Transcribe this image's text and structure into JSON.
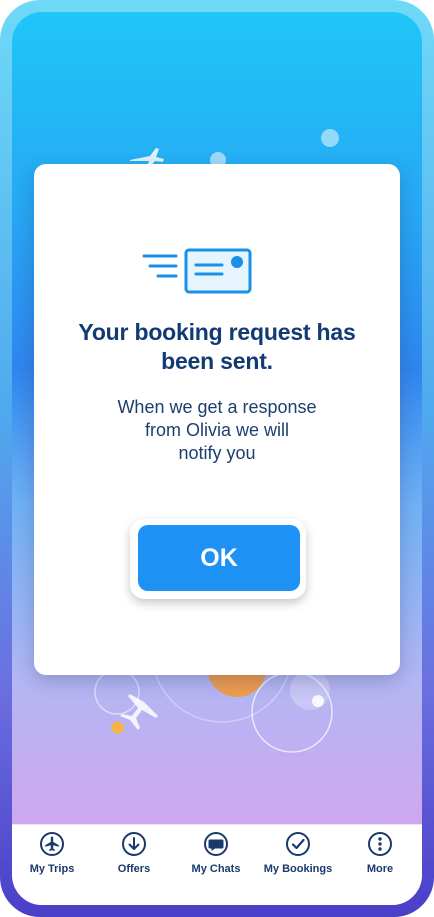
{
  "dialog": {
    "title_line1": "Your booking request has",
    "title_line2": "been sent.",
    "message_line1": "When we get a response",
    "message_line2": "from Olivia we will",
    "message_line3": "notify you",
    "ok_label": "OK",
    "illustration_icon": "envelope-speed-icon"
  },
  "tabbar": {
    "items": [
      {
        "label": "My Trips",
        "icon": "airplane-icon"
      },
      {
        "label": "Offers",
        "icon": "arrow-down-circle-icon"
      },
      {
        "label": "My Chats",
        "icon": "chat-bubble-icon"
      },
      {
        "label": "My Bookings",
        "icon": "checkmark-circle-icon"
      },
      {
        "label": "More",
        "icon": "more-dots-icon"
      }
    ]
  },
  "colors": {
    "accent": "#1e91f5",
    "title": "#123a73",
    "tab_icon": "#193a6b"
  }
}
